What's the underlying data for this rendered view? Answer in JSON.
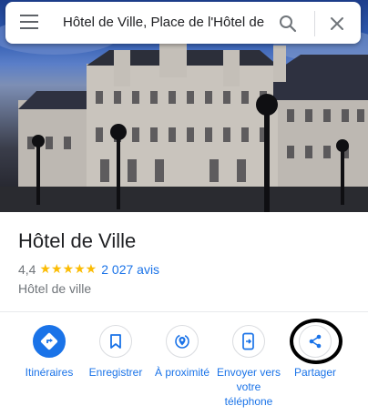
{
  "search": {
    "value": "Hôtel de Ville, Place de l'Hôtel de"
  },
  "place": {
    "name": "Hôtel de Ville",
    "rating": "4,4",
    "stars": "★★★★★",
    "reviews": "2 027 avis",
    "category": "Hôtel de ville"
  },
  "actions": [
    {
      "label": "Itinéraires",
      "icon": "directions-icon"
    },
    {
      "label": "Enregistrer",
      "icon": "bookmark-icon"
    },
    {
      "label": "À proximité",
      "icon": "nearby-icon"
    },
    {
      "label": "Envoyer vers votre téléphone",
      "icon": "send-to-phone-icon"
    },
    {
      "label": "Partager",
      "icon": "share-icon"
    }
  ],
  "colors": {
    "accent": "#1a73e8",
    "star": "#fbbc04",
    "text": "#202124",
    "secondary": "#70757a"
  }
}
